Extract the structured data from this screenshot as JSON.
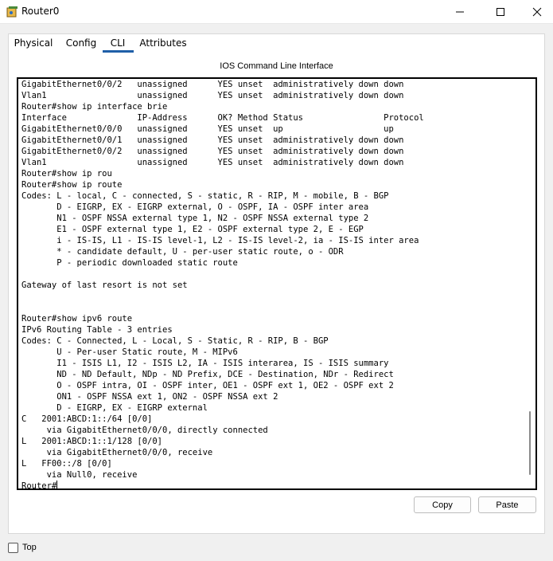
{
  "window": {
    "title": "Router0",
    "icon": "router-icon"
  },
  "tabs": [
    {
      "label": "Physical",
      "active": false
    },
    {
      "label": "Config",
      "active": false
    },
    {
      "label": "CLI",
      "active": true
    },
    {
      "label": "Attributes",
      "active": false
    }
  ],
  "cli": {
    "header": "IOS Command Line Interface",
    "lines": [
      "GigabitEthernet0/0/2   unassigned      YES unset  administratively down down",
      "Vlan1                  unassigned      YES unset  administratively down down",
      "Router#show ip interface brie",
      "Interface              IP-Address      OK? Method Status                Protocol",
      "GigabitEthernet0/0/0   unassigned      YES unset  up                    up",
      "GigabitEthernet0/0/1   unassigned      YES unset  administratively down down",
      "GigabitEthernet0/0/2   unassigned      YES unset  administratively down down",
      "Vlan1                  unassigned      YES unset  administratively down down",
      "Router#show ip rou",
      "Router#show ip route",
      "Codes: L - local, C - connected, S - static, R - RIP, M - mobile, B - BGP",
      "       D - EIGRP, EX - EIGRP external, O - OSPF, IA - OSPF inter area",
      "       N1 - OSPF NSSA external type 1, N2 - OSPF NSSA external type 2",
      "       E1 - OSPF external type 1, E2 - OSPF external type 2, E - EGP",
      "       i - IS-IS, L1 - IS-IS level-1, L2 - IS-IS level-2, ia - IS-IS inter area",
      "       * - candidate default, U - per-user static route, o - ODR",
      "       P - periodic downloaded static route",
      "",
      "Gateway of last resort is not set",
      "",
      "",
      "Router#show ipv6 route",
      "IPv6 Routing Table - 3 entries",
      "Codes: C - Connected, L - Local, S - Static, R - RIP, B - BGP",
      "       U - Per-user Static route, M - MIPv6",
      "       I1 - ISIS L1, I2 - ISIS L2, IA - ISIS interarea, IS - ISIS summary",
      "       ND - ND Default, NDp - ND Prefix, DCE - Destination, NDr - Redirect",
      "       O - OSPF intra, OI - OSPF inter, OE1 - OSPF ext 1, OE2 - OSPF ext 2",
      "       ON1 - OSPF NSSA ext 1, ON2 - OSPF NSSA ext 2",
      "       D - EIGRP, EX - EIGRP external",
      "C   2001:ABCD:1::/64 [0/0]",
      "     via GigabitEthernet0/0/0, directly connected",
      "L   2001:ABCD:1::1/128 [0/0]",
      "     via GigabitEthernet0/0/0, receive",
      "L   FF00::/8 [0/0]",
      "     via Null0, receive",
      "Router#"
    ]
  },
  "buttons": {
    "copy": "Copy",
    "paste": "Paste"
  },
  "footer": {
    "top_label": "Top",
    "top_checked": false
  },
  "colors": {
    "active_tab_underline": "#1f5fa8"
  }
}
